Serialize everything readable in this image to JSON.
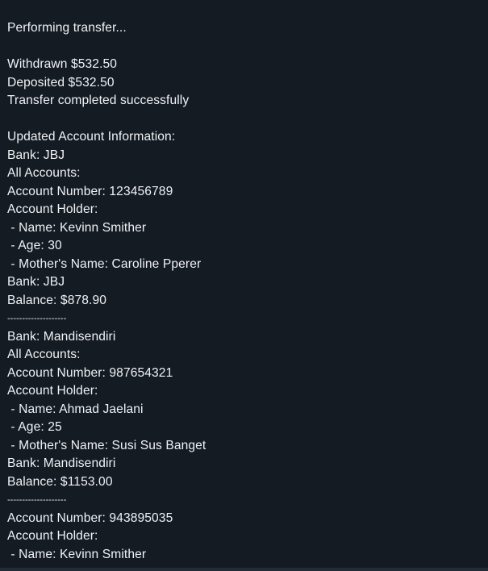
{
  "terminal": {
    "lines": [
      "Performing transfer...",
      "",
      "Withdrawn $532.50",
      "Deposited $532.50",
      "Transfer completed successfully",
      "",
      "Updated Account Information:",
      "Bank: JBJ",
      "All Accounts:",
      "Account Number: 123456789",
      "Account Holder:",
      " - Name: Kevinn Smither",
      " - Age: 30",
      " - Mother's Name: Caroline Pperer",
      "Bank: JBJ",
      "Balance: $878.90",
      "--------------------",
      "Bank: Mandisendiri",
      "All Accounts:",
      "Account Number: 987654321",
      "Account Holder:",
      " - Name: Ahmad Jaelani",
      " - Age: 25",
      " - Mother's Name: Susi Sus Banget",
      "Bank: Mandisendiri",
      "Balance: $1153.00",
      "--------------------",
      "Account Number: 943895035",
      "Account Holder:",
      " - Name: Kevinn Smither"
    ]
  },
  "colors": {
    "background": "#151b23",
    "text": "#f0f3f6"
  }
}
